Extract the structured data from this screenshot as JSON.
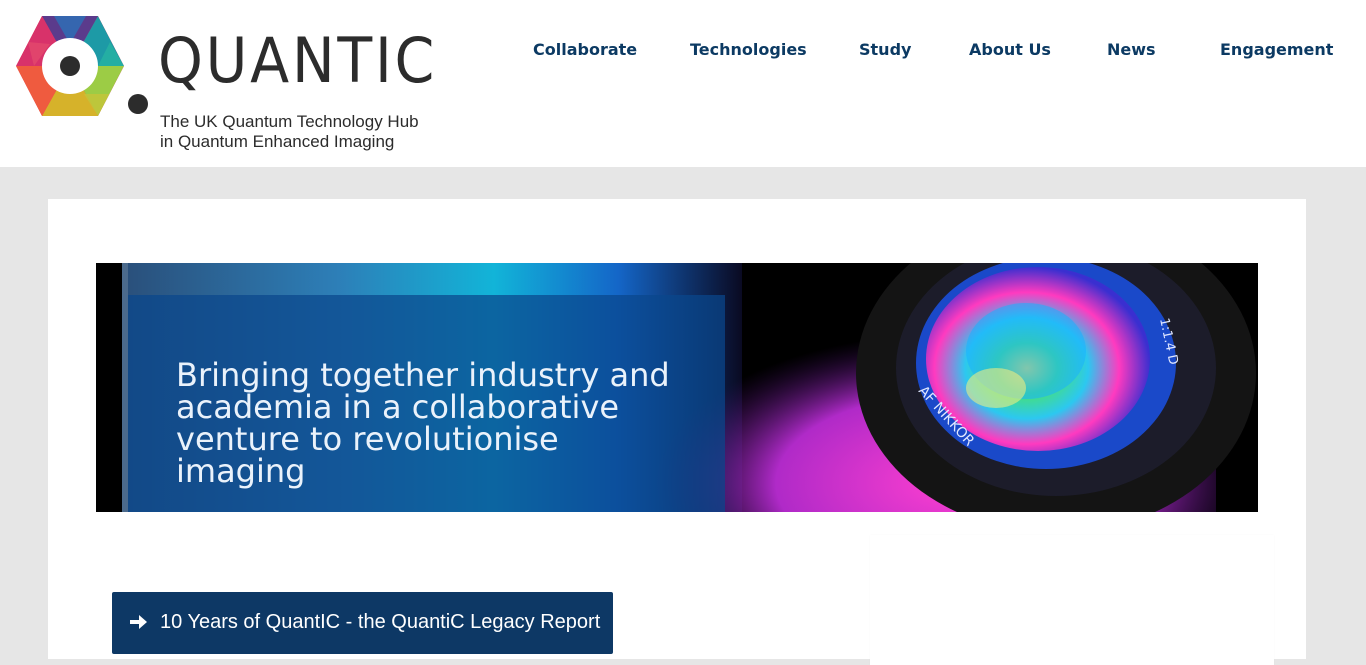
{
  "logo": {
    "wordmark": "QUANTIC",
    "tagline_line1": "The UK Quantum Technology Hub",
    "tagline_line2": "in Quantum Enhanced Imaging"
  },
  "nav": {
    "items": [
      {
        "label": "Collaborate"
      },
      {
        "label": "Technologies"
      },
      {
        "label": "Study"
      },
      {
        "label": "About Us"
      },
      {
        "label": "News"
      },
      {
        "label": "Engagement"
      }
    ]
  },
  "hero": {
    "headline": "Bringing together industry and academia in a collaborative venture to revolutionise imaging",
    "lens_text_1": "AF NIKKOR",
    "lens_text_2": "1:1.4 D"
  },
  "cta": {
    "label": "10 Years of QuantIC - the QuantiC Legacy Report",
    "icon": "arrow-right-icon"
  },
  "colors": {
    "nav_text": "#0c3a63",
    "button_bg": "#0d3865",
    "page_bg": "#e6e6e6"
  }
}
